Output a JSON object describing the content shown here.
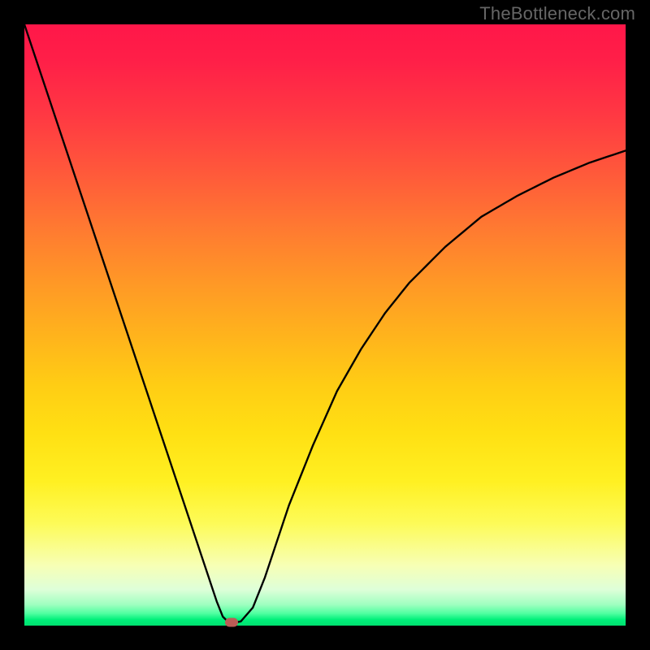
{
  "watermark": "TheBottleneck.com",
  "chart_data": {
    "type": "line",
    "title": "",
    "xlabel": "",
    "ylabel": "",
    "xlim": [
      0,
      100
    ],
    "ylim": [
      0,
      100
    ],
    "grid": false,
    "legend": false,
    "series": [
      {
        "name": "curve",
        "color": "#000000",
        "x": [
          0,
          4,
          8,
          12,
          16,
          20,
          24,
          28,
          30,
          32,
          33,
          34,
          35,
          36,
          38,
          40,
          44,
          48,
          52,
          56,
          60,
          64,
          70,
          76,
          82,
          88,
          94,
          100
        ],
        "y": [
          100,
          88,
          76,
          64,
          52,
          40,
          28,
          16,
          10,
          4,
          1.5,
          0.5,
          0.5,
          0.7,
          3,
          8,
          20,
          30,
          39,
          46,
          52,
          57,
          63,
          68,
          71.5,
          74.5,
          77,
          79
        ]
      }
    ],
    "annotations": [
      {
        "name": "min-marker",
        "x": 34.5,
        "y": 0.5,
        "color": "#bb5c56"
      }
    ],
    "background_gradient": {
      "direction": "vertical",
      "stops": [
        {
          "pos": 0,
          "color": "#ff1749"
        },
        {
          "pos": 0.5,
          "color": "#ffb41c"
        },
        {
          "pos": 0.85,
          "color": "#fdfb58"
        },
        {
          "pos": 1.0,
          "color": "#00e070"
        }
      ]
    }
  }
}
